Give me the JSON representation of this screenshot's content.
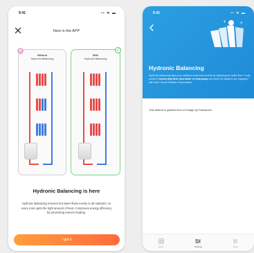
{
  "left_screen": {
    "status": {
      "time": "9:41",
      "icons": "▪▪ ᯤ ▬"
    },
    "title": "New in the APP",
    "comparison": {
      "without_label_bold": "Without",
      "without_label": "Hydronic Balancing",
      "with_label_bold": "With",
      "with_label": "Hydronic Balancing"
    },
    "headline": "Hydronic Balancing is here",
    "description": "Hydronic Balancing ensures hot water flows evenly to all radiators, so every room gets the right amount of heat. It improves energy efficiency by preventing uneven heating.",
    "cta_label": "I got it"
  },
  "right_screen": {
    "status": {
      "time": "9:41",
      "icons": "▪▪ ᯤ ▬"
    },
    "title": "Hydronic Balancing",
    "description_pre": "Hydronic balancing helps your radiators heat more evenly by adjusting the water flow. It only works in ",
    "description_bold": "homes with their own boiler or heat pump",
    "description_post": " and when all radiators are equipped with tado° Smart Radiator Thermostats.",
    "note": "This feature is granted free of charge by Panasonic.",
    "tabs": [
      {
        "label": "Home"
      },
      {
        "label": "Settings"
      },
      {
        "label": "More"
      }
    ]
  },
  "colors": {
    "accent_blue": "#2c9fe3",
    "accent_orange": "#ff7a3b",
    "pipe_hot": "#e84a4a",
    "pipe_cold": "#3d7de0",
    "success_green": "#4bc45a"
  }
}
